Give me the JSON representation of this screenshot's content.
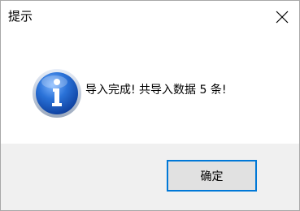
{
  "dialog": {
    "title": "提示",
    "message": "导入完成! 共导入数据 5 条!",
    "ok_label": "确定",
    "icon": "info-icon",
    "close_icon": "close-icon"
  },
  "colors": {
    "accent": "#0078d7",
    "footer_bg": "#f0f0f0",
    "button_bg": "#e1e1e1"
  }
}
